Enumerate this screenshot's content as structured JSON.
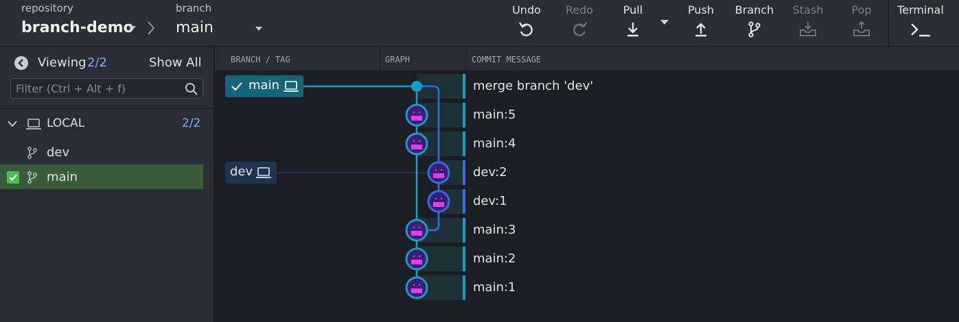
{
  "toolbar": {
    "repo_label": "repository",
    "repo_name": "branch-demo",
    "branch_label": "branch",
    "branch_name": "main",
    "actions": [
      {
        "label": "Undo",
        "icon": "undo-icon",
        "enabled": true
      },
      {
        "label": "Redo",
        "icon": "redo-icon",
        "enabled": false
      },
      {
        "label": "Pull",
        "icon": "pull-icon",
        "enabled": true
      },
      {
        "label": "Push",
        "icon": "push-icon",
        "enabled": true
      },
      {
        "label": "Branch",
        "icon": "branch-icon",
        "enabled": true
      },
      {
        "label": "Stash",
        "icon": "stash-icon",
        "enabled": false
      },
      {
        "label": "Pop",
        "icon": "pop-icon",
        "enabled": false
      },
      {
        "label": "Terminal",
        "icon": "terminal-icon",
        "enabled": true
      }
    ]
  },
  "left_panel": {
    "viewing_label": "Viewing",
    "viewing_count": "2/2",
    "show_all_label": "Show All",
    "filter_placeholder": "Filter (Ctrl + Alt + f)",
    "local_label": "LOCAL",
    "local_count": "2/2",
    "branches": [
      {
        "name": "dev",
        "selected": false
      },
      {
        "name": "main",
        "selected": true
      }
    ]
  },
  "graph": {
    "columns": [
      "BRANCH / TAG",
      "GRAPH",
      "COMMIT MESSAGE"
    ],
    "commits": [
      {
        "message": "merge branch 'dev'",
        "lane": "main",
        "merge": true
      },
      {
        "message": "main:5",
        "lane": "main"
      },
      {
        "message": "main:4",
        "lane": "main"
      },
      {
        "message": "dev:2",
        "lane": "dev"
      },
      {
        "message": "dev:1",
        "lane": "dev"
      },
      {
        "message": "main:3",
        "lane": "main"
      },
      {
        "message": "main:2",
        "lane": "main"
      },
      {
        "message": "main:1",
        "lane": "main"
      }
    ],
    "refs": [
      {
        "name": "main",
        "checked_out": true
      },
      {
        "name": "dev",
        "checked_out": false
      }
    ]
  },
  "colors": {
    "main_lane": "#1b9cc7",
    "dev_lane": "#2f6ee6",
    "selected_branch_bg": "#3a5c3d",
    "accent_count": "#7eaefc"
  }
}
